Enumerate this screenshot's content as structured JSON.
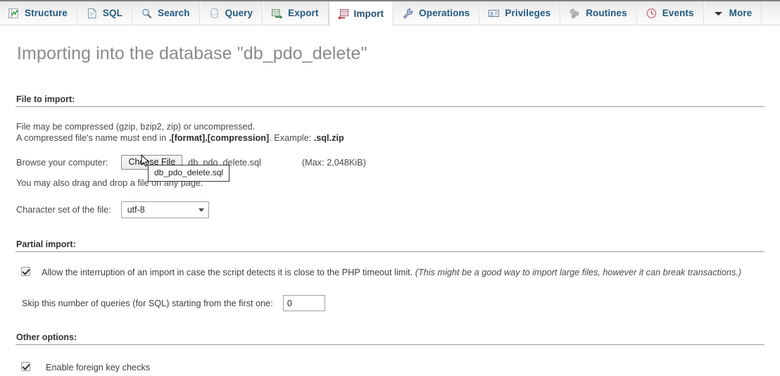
{
  "tabs": [
    {
      "label": "Structure",
      "icon": "structure-icon",
      "active": false
    },
    {
      "label": "SQL",
      "icon": "sql-icon",
      "active": false
    },
    {
      "label": "Search",
      "icon": "search-icon",
      "active": false
    },
    {
      "label": "Query",
      "icon": "query-icon",
      "active": false
    },
    {
      "label": "Export",
      "icon": "export-icon",
      "active": false
    },
    {
      "label": "Import",
      "icon": "import-icon",
      "active": true
    },
    {
      "label": "Operations",
      "icon": "wrench-icon",
      "active": false
    },
    {
      "label": "Privileges",
      "icon": "privileges-icon",
      "active": false
    },
    {
      "label": "Routines",
      "icon": "routines-icon",
      "active": false
    },
    {
      "label": "Events",
      "icon": "clock-icon",
      "active": false
    },
    {
      "label": "More",
      "icon": "chevron-down-icon",
      "active": false
    }
  ],
  "page": {
    "title": "Importing into the database \"db_pdo_delete\""
  },
  "file_section": {
    "legend": "File to import:",
    "note_line1": "File may be compressed (gzip, bzip2, zip) or uncompressed.",
    "note_line2_pre": "A compressed file's name must end in ",
    "note_line2_bold1": ".[format].[compression]",
    "note_line2_mid": ". Example: ",
    "note_line2_bold2": ".sql.zip",
    "browse_label": "Browse your computer:",
    "choose_button": "Choose File",
    "chosen_file": "db_pdo_delete.sql",
    "max_note": "(Max: 2,048KiB)",
    "drag_label": "You may also drag and drop a file on any page.",
    "tooltip": "db_pdo_delete.sql",
    "charset_label": "Character set of the file:",
    "charset_value": "utf-8"
  },
  "partial_section": {
    "legend": "Partial import:",
    "allow_checked": true,
    "allow_text": "Allow the interruption of an import in case the script detects it is close to the PHP timeout limit.",
    "allow_hint": "(This might be a good way to import large files, however it can break transactions.)",
    "skip_label": "Skip this number of queries (for SQL) starting from the first one:",
    "skip_value": "0"
  },
  "other_section": {
    "legend": "Other options:",
    "fk_checked": true,
    "fk_label": "Enable foreign key checks"
  },
  "colors": {
    "tab_text": "#235a81",
    "title_text": "#8a8a8a",
    "legend_rule": "#9b9b9b",
    "body_text": "#4a4a4a"
  }
}
